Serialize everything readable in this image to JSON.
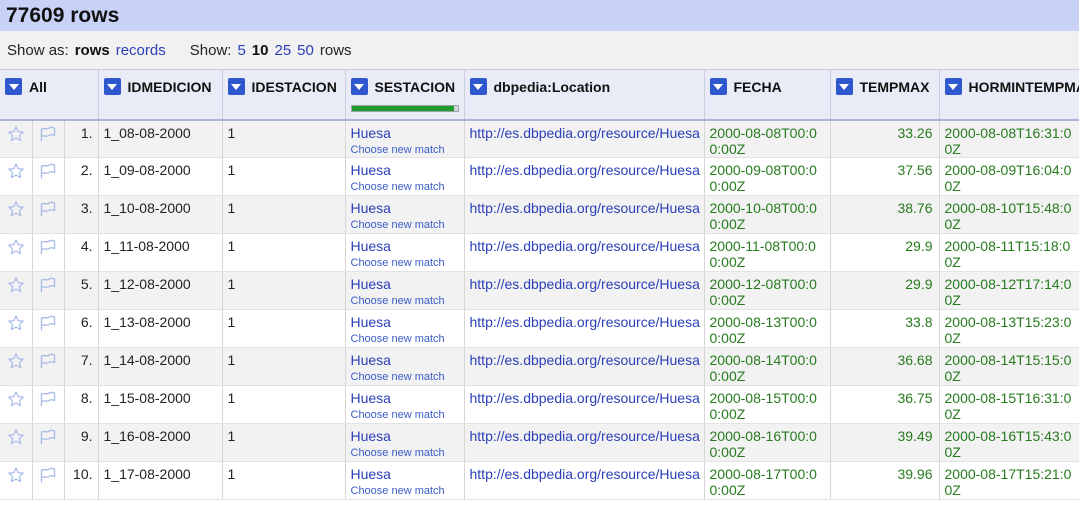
{
  "header": {
    "title": "77609 rows"
  },
  "options": {
    "show_as_label": "Show as:",
    "rows_label": "rows",
    "records_label": "records",
    "show_label": "Show:",
    "page_sizes": [
      "5",
      "10",
      "25",
      "50"
    ],
    "rows_suffix": "rows"
  },
  "columns": {
    "all": "All",
    "idmedicion": "IDMEDICION",
    "idestacion": "IDESTACION",
    "sestacion": "SESTACION",
    "location": "dbpedia:Location",
    "fecha": "FECHA",
    "tempmax": "TEMPMAX",
    "hormintempmax": "HORMINTEMPMAX"
  },
  "sestacion_recon_progress": 0.97,
  "choose_new_match": "Choose new match",
  "rows": [
    {
      "idx": "1.",
      "idmedicion": "1_08-08-2000",
      "idestacion": "1",
      "sestacion": "Huesa",
      "location": "http://es.dbpedia.org/resource/Huesa",
      "fecha": "2000-08-08T00:00:00Z",
      "tempmax": "33.26",
      "hormin": "2000-08-08T16:31:00Z"
    },
    {
      "idx": "2.",
      "idmedicion": "1_09-08-2000",
      "idestacion": "1",
      "sestacion": "Huesa",
      "location": "http://es.dbpedia.org/resource/Huesa",
      "fecha": "2000-09-08T00:00:00Z",
      "tempmax": "37.56",
      "hormin": "2000-08-09T16:04:00Z"
    },
    {
      "idx": "3.",
      "idmedicion": "1_10-08-2000",
      "idestacion": "1",
      "sestacion": "Huesa",
      "location": "http://es.dbpedia.org/resource/Huesa",
      "fecha": "2000-10-08T00:00:00Z",
      "tempmax": "38.76",
      "hormin": "2000-08-10T15:48:00Z"
    },
    {
      "idx": "4.",
      "idmedicion": "1_11-08-2000",
      "idestacion": "1",
      "sestacion": "Huesa",
      "location": "http://es.dbpedia.org/resource/Huesa",
      "fecha": "2000-11-08T00:00:00Z",
      "tempmax": "29.9",
      "hormin": "2000-08-11T15:18:00Z"
    },
    {
      "idx": "5.",
      "idmedicion": "1_12-08-2000",
      "idestacion": "1",
      "sestacion": "Huesa",
      "location": "http://es.dbpedia.org/resource/Huesa",
      "fecha": "2000-12-08T00:00:00Z",
      "tempmax": "29.9",
      "hormin": "2000-08-12T17:14:00Z"
    },
    {
      "idx": "6.",
      "idmedicion": "1_13-08-2000",
      "idestacion": "1",
      "sestacion": "Huesa",
      "location": "http://es.dbpedia.org/resource/Huesa",
      "fecha": "2000-08-13T00:00:00Z",
      "tempmax": "33.8",
      "hormin": "2000-08-13T15:23:00Z"
    },
    {
      "idx": "7.",
      "idmedicion": "1_14-08-2000",
      "idestacion": "1",
      "sestacion": "Huesa",
      "location": "http://es.dbpedia.org/resource/Huesa",
      "fecha": "2000-08-14T00:00:00Z",
      "tempmax": "36.68",
      "hormin": "2000-08-14T15:15:00Z"
    },
    {
      "idx": "8.",
      "idmedicion": "1_15-08-2000",
      "idestacion": "1",
      "sestacion": "Huesa",
      "location": "http://es.dbpedia.org/resource/Huesa",
      "fecha": "2000-08-15T00:00:00Z",
      "tempmax": "36.75",
      "hormin": "2000-08-15T16:31:00Z"
    },
    {
      "idx": "9.",
      "idmedicion": "1_16-08-2000",
      "idestacion": "1",
      "sestacion": "Huesa",
      "location": "http://es.dbpedia.org/resource/Huesa",
      "fecha": "2000-08-16T00:00:00Z",
      "tempmax": "39.49",
      "hormin": "2000-08-16T15:43:00Z"
    },
    {
      "idx": "10.",
      "idmedicion": "1_17-08-2000",
      "idestacion": "1",
      "sestacion": "Huesa",
      "location": "http://es.dbpedia.org/resource/Huesa",
      "fecha": "2000-08-17T00:00:00Z",
      "tempmax": "39.96",
      "hormin": "2000-08-17T15:21:00Z"
    }
  ],
  "icons": {
    "star": "star-icon",
    "flag": "flag-icon",
    "dropdown": "dropdown-arrow-icon"
  },
  "colors": {
    "title_bg": "#c8d2f7",
    "link": "#2a3fb8",
    "value_green": "#287a1f",
    "dropdown": "#2f58cf"
  }
}
